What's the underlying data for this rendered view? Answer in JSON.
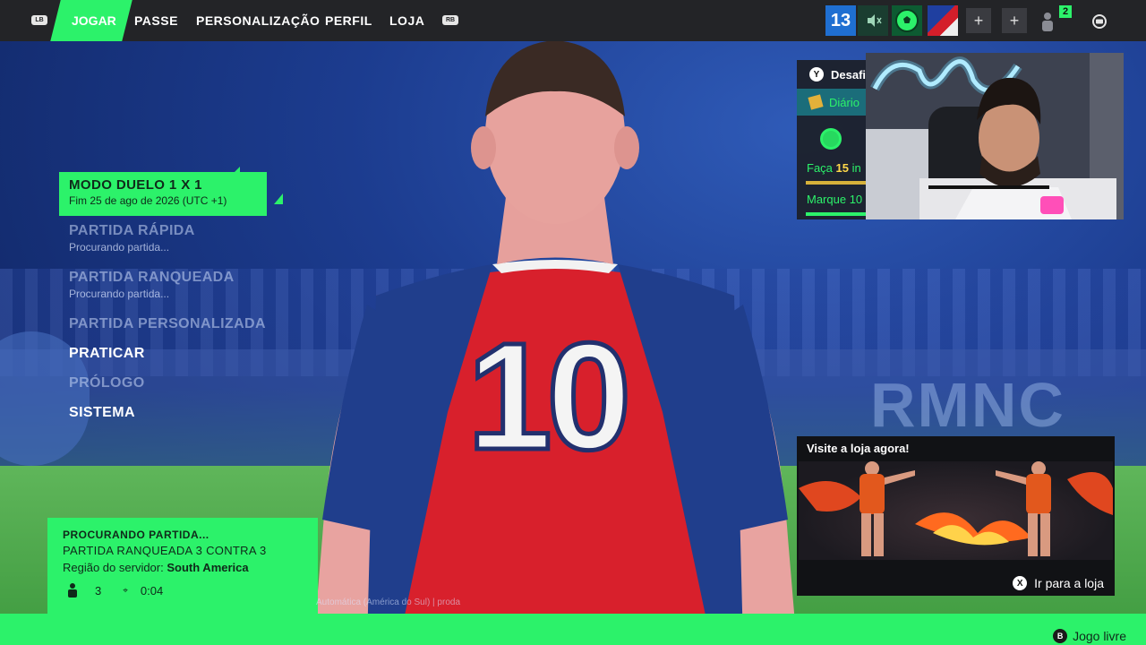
{
  "topbar": {
    "left_bumper": "LB",
    "right_bumper": "RB",
    "tabs": [
      {
        "label": "JOGAR",
        "active": true
      },
      {
        "label": "PASSE"
      },
      {
        "label": "PERSONALIZAÇÃO"
      },
      {
        "label": "PERFIL"
      },
      {
        "label": "LOJA"
      }
    ],
    "level": "13",
    "icons": [
      "mute-icon",
      "ball-icon",
      "flag-icon",
      "plus-icon",
      "plus-icon",
      "friends-icon",
      "chat-icon"
    ],
    "friends_count": "2",
    "accent_color": "#2cf26a"
  },
  "menu": {
    "mode_title": "MODO DUELO 1 X 1",
    "mode_subtitle": "Fim 25 de ago de 2026 (UTC +1)",
    "items": [
      {
        "label": "PARTIDA RÁPIDA",
        "status": "Procurando partida..."
      },
      {
        "label": "PARTIDA RANQUEADA",
        "status": "Procurando partida..."
      },
      {
        "label": "PARTIDA PERSONALIZADA"
      },
      {
        "label": "PRATICAR"
      },
      {
        "label": "PRÓLOGO"
      },
      {
        "label": "SISTEMA"
      }
    ]
  },
  "matchmaking": {
    "title": "PROCURANDO PARTIDA...",
    "mode": "PARTIDA RANQUEADA 3 CONTRA 3",
    "region_label": "Região do servidor:",
    "region_value": "South America",
    "players": "3",
    "timer": "0:04"
  },
  "version_text": "Automática (América do Sul) | proda",
  "challenges": {
    "button": "Y",
    "title": "Desafi",
    "tab": "Diário",
    "task1_prefix": "Faça",
    "task1_number": "15",
    "task1_suffix": "in",
    "task2": "Marque 10"
  },
  "store": {
    "title": "Visite a loja agora!",
    "button_key": "X",
    "button_label": "Ir para a loja"
  },
  "bottombar": {
    "button_key": "B",
    "label": "Jogo livre"
  },
  "scene": {
    "jersey_number": "10",
    "sponsor": "RMNC"
  }
}
